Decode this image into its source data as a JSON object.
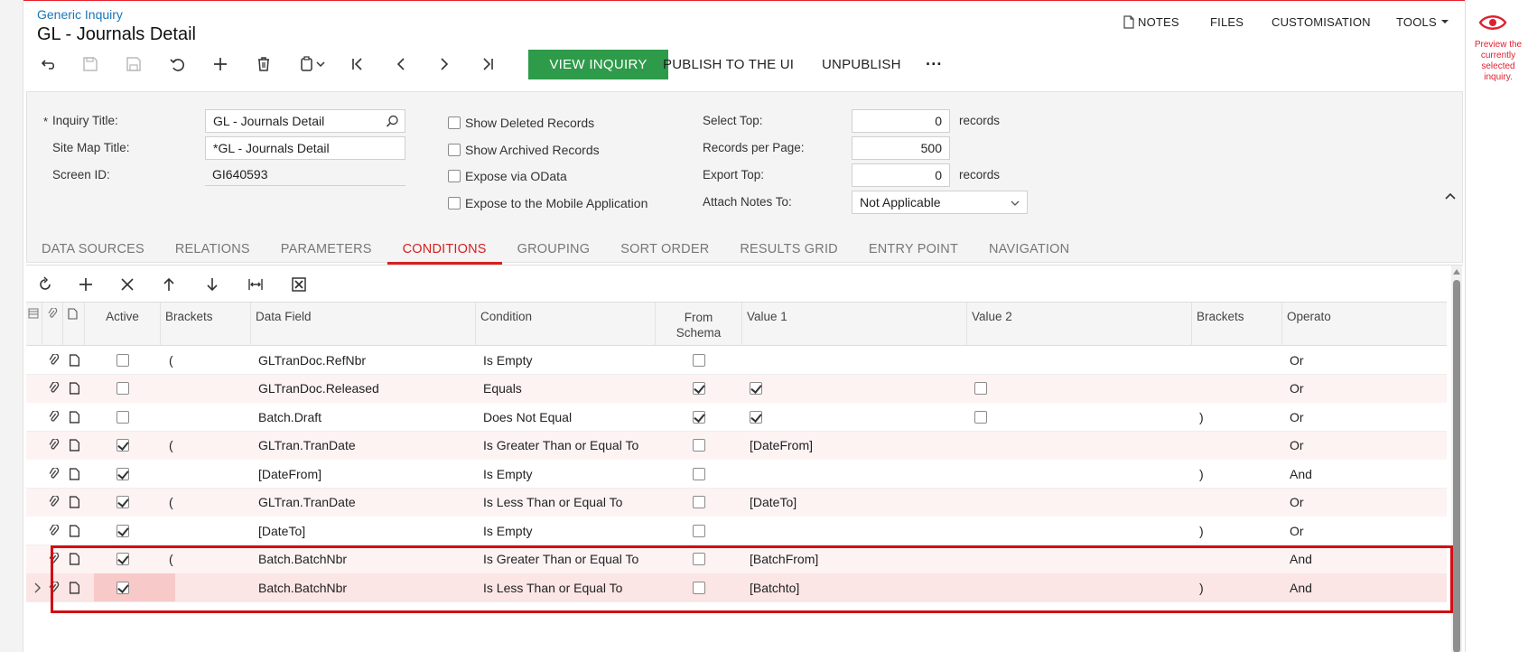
{
  "header": {
    "breadcrumb": "Generic Inquiry",
    "title": "GL - Journals Detail",
    "links": {
      "notes": "NOTES",
      "files": "FILES",
      "customisation": "CUSTOMISATION",
      "tools": "TOOLS"
    }
  },
  "toolbar": {
    "view_inquiry": "VIEW INQUIRY",
    "publish": "PUBLISH TO THE UI",
    "unpublish": "UNPUBLISH",
    "more": "···"
  },
  "preview": {
    "text": "Preview the currently selected inquiry."
  },
  "form": {
    "inquiry_title_label": "Inquiry Title:",
    "inquiry_title_value": "GL - Journals Detail",
    "site_map_title_label": "Site Map Title:",
    "site_map_title_value": "*GL - Journals Detail",
    "screen_id_label": "Screen ID:",
    "screen_id_value": "GI640593",
    "show_deleted": "Show Deleted Records",
    "show_archived": "Show Archived Records",
    "expose_odata": "Expose via OData",
    "expose_mobile": "Expose to the Mobile Application",
    "select_top_label": "Select Top:",
    "select_top_value": "0",
    "records_per_page_label": "Records per Page:",
    "records_per_page_value": "500",
    "export_top_label": "Export Top:",
    "export_top_value": "0",
    "records_unit": "records",
    "attach_notes_label": "Attach Notes To:",
    "attach_notes_value": "Not Applicable"
  },
  "tabs": [
    "DATA SOURCES",
    "RELATIONS",
    "PARAMETERS",
    "CONDITIONS",
    "GROUPING",
    "SORT ORDER",
    "RESULTS GRID",
    "ENTRY POINT",
    "NAVIGATION"
  ],
  "grid": {
    "headers": {
      "active": "Active",
      "brackets_open": "Brackets",
      "data_field": "Data Field",
      "condition": "Condition",
      "from_schema_1": "From",
      "from_schema_2": "Schema",
      "value1": "Value 1",
      "value2": "Value 2",
      "brackets_close": "Brackets",
      "operator": "Operato"
    },
    "rows": [
      {
        "active": false,
        "open": "(",
        "field": "GLTranDoc.RefNbr",
        "condition": "Is Empty",
        "from_schema": false,
        "value1": "",
        "value1_check": null,
        "value2_check": null,
        "close": "",
        "op": "Or"
      },
      {
        "active": false,
        "open": "",
        "field": "GLTranDoc.Released",
        "condition": "Equals",
        "from_schema": true,
        "value1": "",
        "value1_check": true,
        "value2_check": false,
        "close": "",
        "op": "Or"
      },
      {
        "active": false,
        "open": "",
        "field": "Batch.Draft",
        "condition": "Does Not Equal",
        "from_schema": true,
        "value1": "",
        "value1_check": true,
        "value2_check": false,
        "close": ")",
        "op": "Or"
      },
      {
        "active": true,
        "open": "(",
        "field": "GLTran.TranDate",
        "condition": "Is Greater Than or Equal To",
        "from_schema": false,
        "value1": "[DateFrom]",
        "value1_check": null,
        "value2_check": null,
        "close": "",
        "op": "Or"
      },
      {
        "active": true,
        "open": "",
        "field": "[DateFrom]",
        "condition": "Is Empty",
        "from_schema": false,
        "value1": "",
        "value1_check": null,
        "value2_check": null,
        "close": ")",
        "op": "And"
      },
      {
        "active": true,
        "open": "(",
        "field": "GLTran.TranDate",
        "condition": "Is Less Than or Equal To",
        "from_schema": false,
        "value1": "[DateTo]",
        "value1_check": null,
        "value2_check": null,
        "close": "",
        "op": "Or"
      },
      {
        "active": true,
        "open": "",
        "field": "[DateTo]",
        "condition": "Is Empty",
        "from_schema": false,
        "value1": "",
        "value1_check": null,
        "value2_check": null,
        "close": ")",
        "op": "Or"
      },
      {
        "active": true,
        "open": "(",
        "field": "Batch.BatchNbr",
        "condition": "Is Greater Than or Equal To",
        "from_schema": false,
        "value1": "[BatchFrom]",
        "value1_check": null,
        "value2_check": null,
        "close": "",
        "op": "And"
      },
      {
        "active": true,
        "open": "",
        "field": "Batch.BatchNbr",
        "condition": "Is Less Than or Equal To",
        "from_schema": false,
        "value1": "[Batchto]",
        "value1_check": null,
        "value2_check": null,
        "close": ")",
        "op": "And"
      }
    ]
  },
  "colors": {
    "accent_red": "#d62020",
    "view_inquiry_green": "#2e9b4a",
    "link_blue": "#1a77b8"
  }
}
